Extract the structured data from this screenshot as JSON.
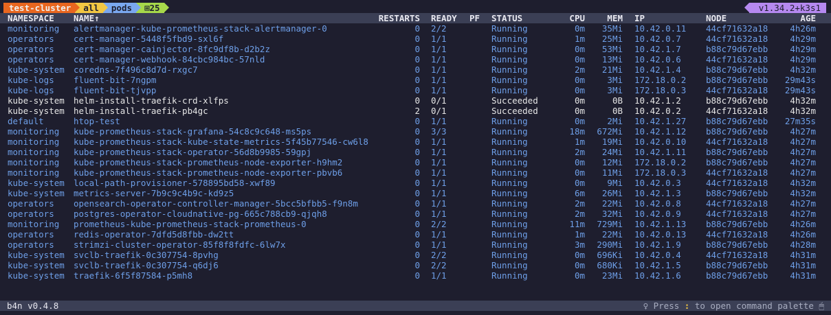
{
  "breadcrumb": {
    "cluster": "test-cluster",
    "namespace": "all",
    "resource": "pods",
    "count": "25"
  },
  "version": "v1.34.2+k3s1",
  "columns": {
    "namespace": "NAMESPACE",
    "name": "NAME↑",
    "restarts": "RESTARTS",
    "ready": "READY",
    "pf": "PF",
    "status": "STATUS",
    "cpu": "CPU",
    "mem": "MEM",
    "ip": "IP",
    "node": "NODE",
    "age": "AGE"
  },
  "pods": [
    {
      "namespace": "monitoring",
      "name": "alertmanager-kube-prometheus-stack-alertmanager-0",
      "restarts": "0",
      "ready": "2/2",
      "pf": "",
      "status": "Running",
      "cpu": "0m",
      "mem": "35Mi",
      "ip": "10.42.0.11",
      "node": "44cf71632a18",
      "age": "4h26m"
    },
    {
      "namespace": "operators",
      "name": "cert-manager-5448f5fbd9-sxl6f",
      "restarts": "0",
      "ready": "1/1",
      "pf": "",
      "status": "Running",
      "cpu": "1m",
      "mem": "25Mi",
      "ip": "10.42.0.7",
      "node": "44cf71632a18",
      "age": "4h29m"
    },
    {
      "namespace": "operators",
      "name": "cert-manager-cainjector-8fc9df8b-d2b2z",
      "restarts": "0",
      "ready": "1/1",
      "pf": "",
      "status": "Running",
      "cpu": "0m",
      "mem": "53Mi",
      "ip": "10.42.1.7",
      "node": "b88c79d67ebb",
      "age": "4h29m"
    },
    {
      "namespace": "operators",
      "name": "cert-manager-webhook-84cbc984bc-57nld",
      "restarts": "0",
      "ready": "1/1",
      "pf": "",
      "status": "Running",
      "cpu": "0m",
      "mem": "13Mi",
      "ip": "10.42.0.6",
      "node": "44cf71632a18",
      "age": "4h29m"
    },
    {
      "namespace": "kube-system",
      "name": "coredns-7f496c8d7d-rxgc7",
      "restarts": "0",
      "ready": "1/1",
      "pf": "",
      "status": "Running",
      "cpu": "2m",
      "mem": "21Mi",
      "ip": "10.42.1.4",
      "node": "b88c79d67ebb",
      "age": "4h32m"
    },
    {
      "namespace": "kube-logs",
      "name": "fluent-bit-7ngpm",
      "restarts": "0",
      "ready": "1/1",
      "pf": "",
      "status": "Running",
      "cpu": "0m",
      "mem": "3Mi",
      "ip": "172.18.0.2",
      "node": "b88c79d67ebb",
      "age": "29m43s"
    },
    {
      "namespace": "kube-logs",
      "name": "fluent-bit-tjvpp",
      "restarts": "0",
      "ready": "1/1",
      "pf": "",
      "status": "Running",
      "cpu": "0m",
      "mem": "3Mi",
      "ip": "172.18.0.3",
      "node": "44cf71632a18",
      "age": "29m43s"
    },
    {
      "namespace": "kube-system",
      "name": "helm-install-traefik-crd-xlfps",
      "restarts": "0",
      "ready": "0/1",
      "pf": "",
      "status": "Succeeded",
      "cpu": "0m",
      "mem": "0B",
      "ip": "10.42.1.2",
      "node": "b88c79d67ebb",
      "age": "4h32m"
    },
    {
      "namespace": "kube-system",
      "name": "helm-install-traefik-pb4gc",
      "restarts": "2",
      "ready": "0/1",
      "pf": "",
      "status": "Succeeded",
      "cpu": "0m",
      "mem": "0B",
      "ip": "10.42.0.2",
      "node": "44cf71632a18",
      "age": "4h32m"
    },
    {
      "namespace": "default",
      "name": "htop-test",
      "restarts": "0",
      "ready": "1/1",
      "pf": "",
      "status": "Running",
      "cpu": "0m",
      "mem": "2Mi",
      "ip": "10.42.1.27",
      "node": "b88c79d67ebb",
      "age": "27m35s"
    },
    {
      "namespace": "monitoring",
      "name": "kube-prometheus-stack-grafana-54c8c9c648-ms5ps",
      "restarts": "0",
      "ready": "3/3",
      "pf": "",
      "status": "Running",
      "cpu": "18m",
      "mem": "672Mi",
      "ip": "10.42.1.12",
      "node": "b88c79d67ebb",
      "age": "4h27m"
    },
    {
      "namespace": "monitoring",
      "name": "kube-prometheus-stack-kube-state-metrics-5f45b77546-cw6l8",
      "restarts": "0",
      "ready": "1/1",
      "pf": "",
      "status": "Running",
      "cpu": "1m",
      "mem": "19Mi",
      "ip": "10.42.0.10",
      "node": "44cf71632a18",
      "age": "4h27m"
    },
    {
      "namespace": "monitoring",
      "name": "kube-prometheus-stack-operator-56d8b9985-59gpj",
      "restarts": "0",
      "ready": "1/1",
      "pf": "",
      "status": "Running",
      "cpu": "2m",
      "mem": "24Mi",
      "ip": "10.42.1.11",
      "node": "b88c79d67ebb",
      "age": "4h27m"
    },
    {
      "namespace": "monitoring",
      "name": "kube-prometheus-stack-prometheus-node-exporter-h9hm2",
      "restarts": "0",
      "ready": "1/1",
      "pf": "",
      "status": "Running",
      "cpu": "0m",
      "mem": "12Mi",
      "ip": "172.18.0.2",
      "node": "b88c79d67ebb",
      "age": "4h27m"
    },
    {
      "namespace": "monitoring",
      "name": "kube-prometheus-stack-prometheus-node-exporter-pbvb6",
      "restarts": "0",
      "ready": "1/1",
      "pf": "",
      "status": "Running",
      "cpu": "0m",
      "mem": "11Mi",
      "ip": "172.18.0.3",
      "node": "44cf71632a18",
      "age": "4h27m"
    },
    {
      "namespace": "kube-system",
      "name": "local-path-provisioner-578895bd58-xwf89",
      "restarts": "0",
      "ready": "1/1",
      "pf": "",
      "status": "Running",
      "cpu": "0m",
      "mem": "9Mi",
      "ip": "10.42.0.3",
      "node": "44cf71632a18",
      "age": "4h32m"
    },
    {
      "namespace": "kube-system",
      "name": "metrics-server-7b9c9c4b9c-kd9z5",
      "restarts": "0",
      "ready": "1/1",
      "pf": "",
      "status": "Running",
      "cpu": "6m",
      "mem": "26Mi",
      "ip": "10.42.1.3",
      "node": "b88c79d67ebb",
      "age": "4h32m"
    },
    {
      "namespace": "operators",
      "name": "opensearch-operator-controller-manager-5bcc5bfbb5-f9n8m",
      "restarts": "0",
      "ready": "1/1",
      "pf": "",
      "status": "Running",
      "cpu": "2m",
      "mem": "22Mi",
      "ip": "10.42.0.8",
      "node": "44cf71632a18",
      "age": "4h27m"
    },
    {
      "namespace": "operators",
      "name": "postgres-operator-cloudnative-pg-665c788cb9-qjqh8",
      "restarts": "0",
      "ready": "1/1",
      "pf": "",
      "status": "Running",
      "cpu": "2m",
      "mem": "32Mi",
      "ip": "10.42.0.9",
      "node": "44cf71632a18",
      "age": "4h27m"
    },
    {
      "namespace": "monitoring",
      "name": "prometheus-kube-prometheus-stack-prometheus-0",
      "restarts": "0",
      "ready": "2/2",
      "pf": "",
      "status": "Running",
      "cpu": "11m",
      "mem": "729Mi",
      "ip": "10.42.1.13",
      "node": "b88c79d67ebb",
      "age": "4h26m"
    },
    {
      "namespace": "operators",
      "name": "redis-operator-7dfd5d8fbb-dw2tt",
      "restarts": "0",
      "ready": "1/1",
      "pf": "",
      "status": "Running",
      "cpu": "1m",
      "mem": "22Mi",
      "ip": "10.42.0.13",
      "node": "44cf71632a18",
      "age": "4h26m"
    },
    {
      "namespace": "operators",
      "name": "strimzi-cluster-operator-85f8f8fdfc-6lw7x",
      "restarts": "0",
      "ready": "1/1",
      "pf": "",
      "status": "Running",
      "cpu": "3m",
      "mem": "290Mi",
      "ip": "10.42.1.9",
      "node": "b88c79d67ebb",
      "age": "4h28m"
    },
    {
      "namespace": "kube-system",
      "name": "svclb-traefik-0c307754-8pvhg",
      "restarts": "0",
      "ready": "2/2",
      "pf": "",
      "status": "Running",
      "cpu": "0m",
      "mem": "696Ki",
      "ip": "10.42.0.4",
      "node": "44cf71632a18",
      "age": "4h31m"
    },
    {
      "namespace": "kube-system",
      "name": "svclb-traefik-0c307754-q6dj6",
      "restarts": "0",
      "ready": "2/2",
      "pf": "",
      "status": "Running",
      "cpu": "0m",
      "mem": "680Ki",
      "ip": "10.42.1.5",
      "node": "b88c79d67ebb",
      "age": "4h31m"
    },
    {
      "namespace": "kube-system",
      "name": "traefik-6f5f87584-p5mh8",
      "restarts": "0",
      "ready": "1/1",
      "pf": "",
      "status": "Running",
      "cpu": "0m",
      "mem": "23Mi",
      "ip": "10.42.1.6",
      "node": "b88c79d67ebb",
      "age": "4h31m"
    }
  ],
  "footer": {
    "app_name": "b4n",
    "app_version": "v0.4.8",
    "hint_prefix": "Press",
    "hint_key": ":",
    "hint_suffix": "to open command palette",
    "hint_icon": "lightbulb-icon",
    "mouse_icon": "mouse-icon"
  },
  "colors": {
    "background": "#1e1e2e",
    "header_bar": "#3b3f55",
    "running_text": "#6e9fe8",
    "succeeded_text": "#e6e6e6",
    "cluster_segment": "#e8661f",
    "namespace_segment": "#f2c743",
    "resource_segment": "#7aa8f0",
    "count_segment": "#a6d84a",
    "version_badge": "#b689f0"
  }
}
